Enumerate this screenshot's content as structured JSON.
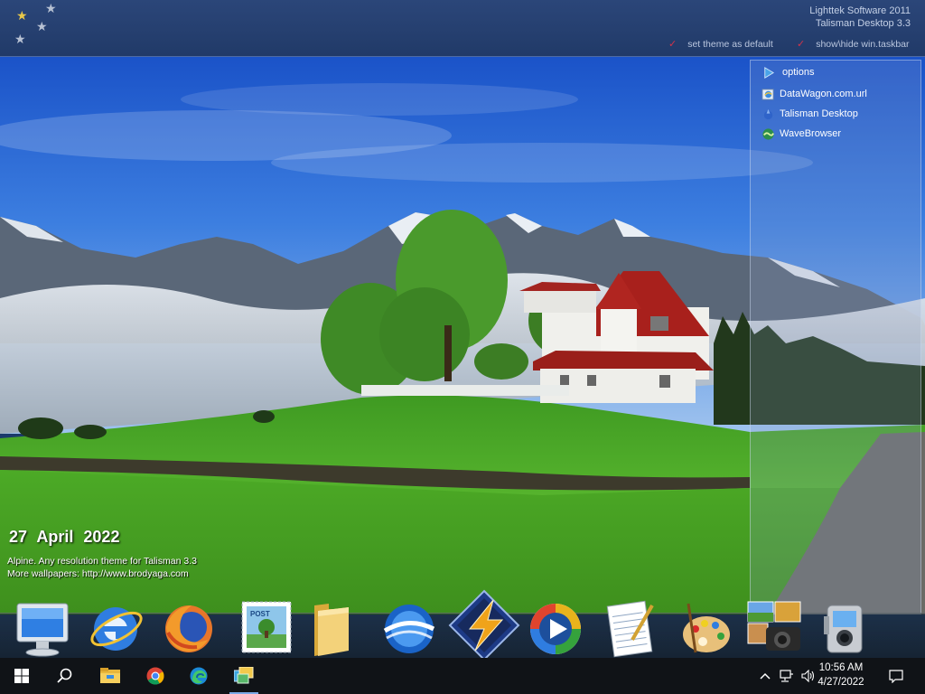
{
  "vendor": {
    "line1": "Lighttek Software 2011",
    "line2": "Talisman Desktop 3.3"
  },
  "top_commands": [
    {
      "label": "set theme as default",
      "mark": "✓"
    },
    {
      "label": "show\\hide win.taskbar",
      "mark": "✓"
    }
  ],
  "panel": {
    "items": [
      {
        "label": "options",
        "icon": "play-triangle-icon"
      },
      {
        "label": "DataWagon.com.url",
        "icon": "internet-shortcut-icon"
      },
      {
        "label": "Talisman Desktop",
        "icon": "talisman-icon"
      },
      {
        "label": "WaveBrowser",
        "icon": "wavebrowser-icon"
      }
    ]
  },
  "date": {
    "day": "27",
    "month": "April",
    "year": "2022"
  },
  "info": {
    "line1": "Alpine. Any resolution theme for Talisman 3.3",
    "line2": "More wallpapers: http://www.brodyaga.com"
  },
  "dock": {
    "icons": [
      "my-computer-icon",
      "internet-explorer-icon",
      "firefox-icon",
      "post-stamp-icon",
      "folder-icon",
      "google-earth-icon",
      "winamp-icon",
      "media-player-icon",
      "notepad-icon",
      "paint-palette-icon",
      "photo-camera-icon",
      "camcorder-icon"
    ],
    "stamp_text": "POST"
  },
  "taskbar": {
    "icons": [
      "windows-start-icon",
      "search-icon",
      "file-explorer-icon",
      "chrome-icon",
      "edge-icon",
      "talisman-taskbar-icon"
    ],
    "tray_icons": [
      "chevron-up-icon",
      "network-icon",
      "volume-icon",
      "notification-icon"
    ],
    "time": "10:56 AM",
    "date": "4/27/2022"
  },
  "colors": {
    "accent_check": "#d2344a",
    "topbar": "#2b4679",
    "taskbar": "#101317"
  }
}
